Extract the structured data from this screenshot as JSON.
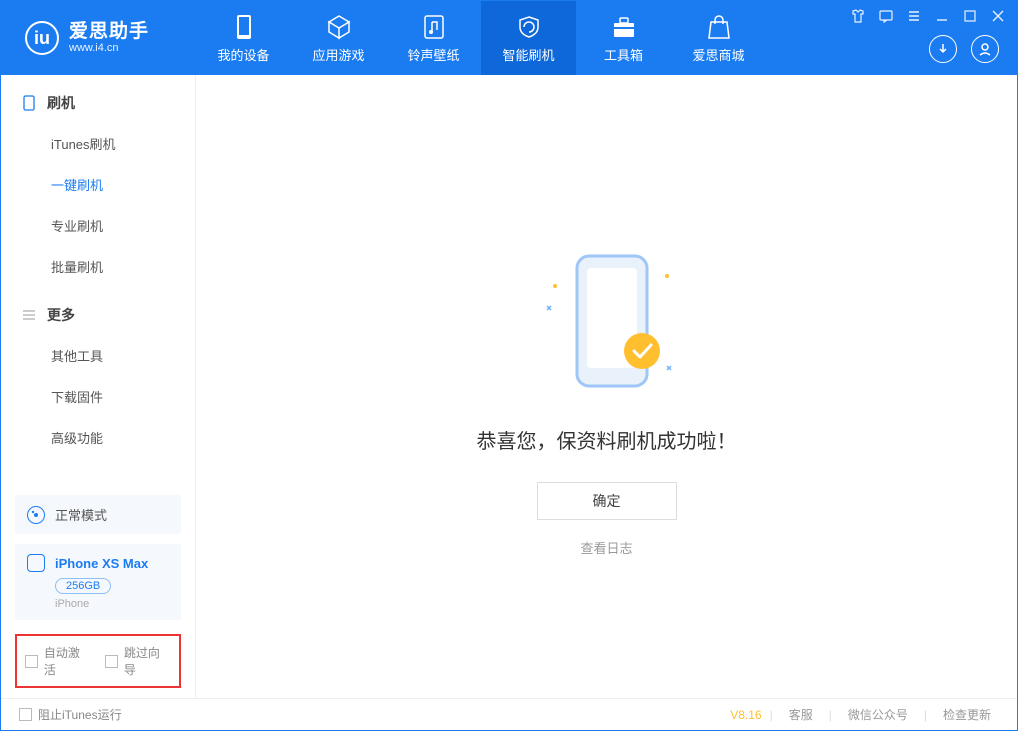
{
  "app": {
    "title": "爱思助手",
    "url": "www.i4.cn"
  },
  "nav": {
    "items": [
      {
        "label": "我的设备"
      },
      {
        "label": "应用游戏"
      },
      {
        "label": "铃声壁纸"
      },
      {
        "label": "智能刷机"
      },
      {
        "label": "工具箱"
      },
      {
        "label": "爱思商城"
      }
    ],
    "active_index": 3
  },
  "sidebar": {
    "section1": {
      "title": "刷机",
      "items": [
        {
          "label": "iTunes刷机"
        },
        {
          "label": "一键刷机"
        },
        {
          "label": "专业刷机"
        },
        {
          "label": "批量刷机"
        }
      ],
      "active_index": 1
    },
    "section2": {
      "title": "更多",
      "items": [
        {
          "label": "其他工具"
        },
        {
          "label": "下载固件"
        },
        {
          "label": "高级功能"
        }
      ]
    },
    "mode": "正常模式",
    "device": {
      "name": "iPhone XS Max",
      "storage": "256GB",
      "type": "iPhone"
    },
    "checkboxes": {
      "auto_activate": "自动激活",
      "skip_guide": "跳过向导"
    }
  },
  "content": {
    "success_message": "恭喜您，保资料刷机成功啦！",
    "ok_button": "确定",
    "view_log": "查看日志"
  },
  "footer": {
    "block_itunes": "阻止iTunes运行",
    "version": "V8.16",
    "links": {
      "service": "客服",
      "wechat": "微信公众号",
      "update": "检查更新"
    }
  }
}
